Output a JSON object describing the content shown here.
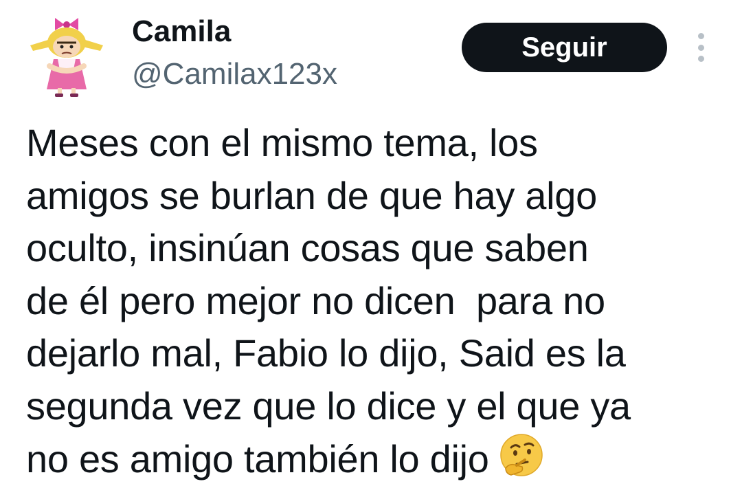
{
  "user": {
    "display_name": "Camila",
    "handle": "@Camilax123x"
  },
  "actions": {
    "follow_label": "Seguir",
    "more_icon": "more-vertical-icon"
  },
  "tweet": {
    "text": "Meses con el mismo tema, los\namigos se burlan de que hay algo\noculto, insinúan cosas que saben\nde él pero mejor no dicen  para no\ndejarlo mal, Fabio lo dijo, Said es la\nsegunda vez que lo dice y el que ya\nno es amigo también lo dijo",
    "emoji": "thinking-face-icon"
  },
  "colors": {
    "text_primary": "#0f1419",
    "text_secondary": "#536471",
    "button_bg": "#0f1419",
    "button_text": "#ffffff",
    "more_dots": "#b8c0c7"
  }
}
